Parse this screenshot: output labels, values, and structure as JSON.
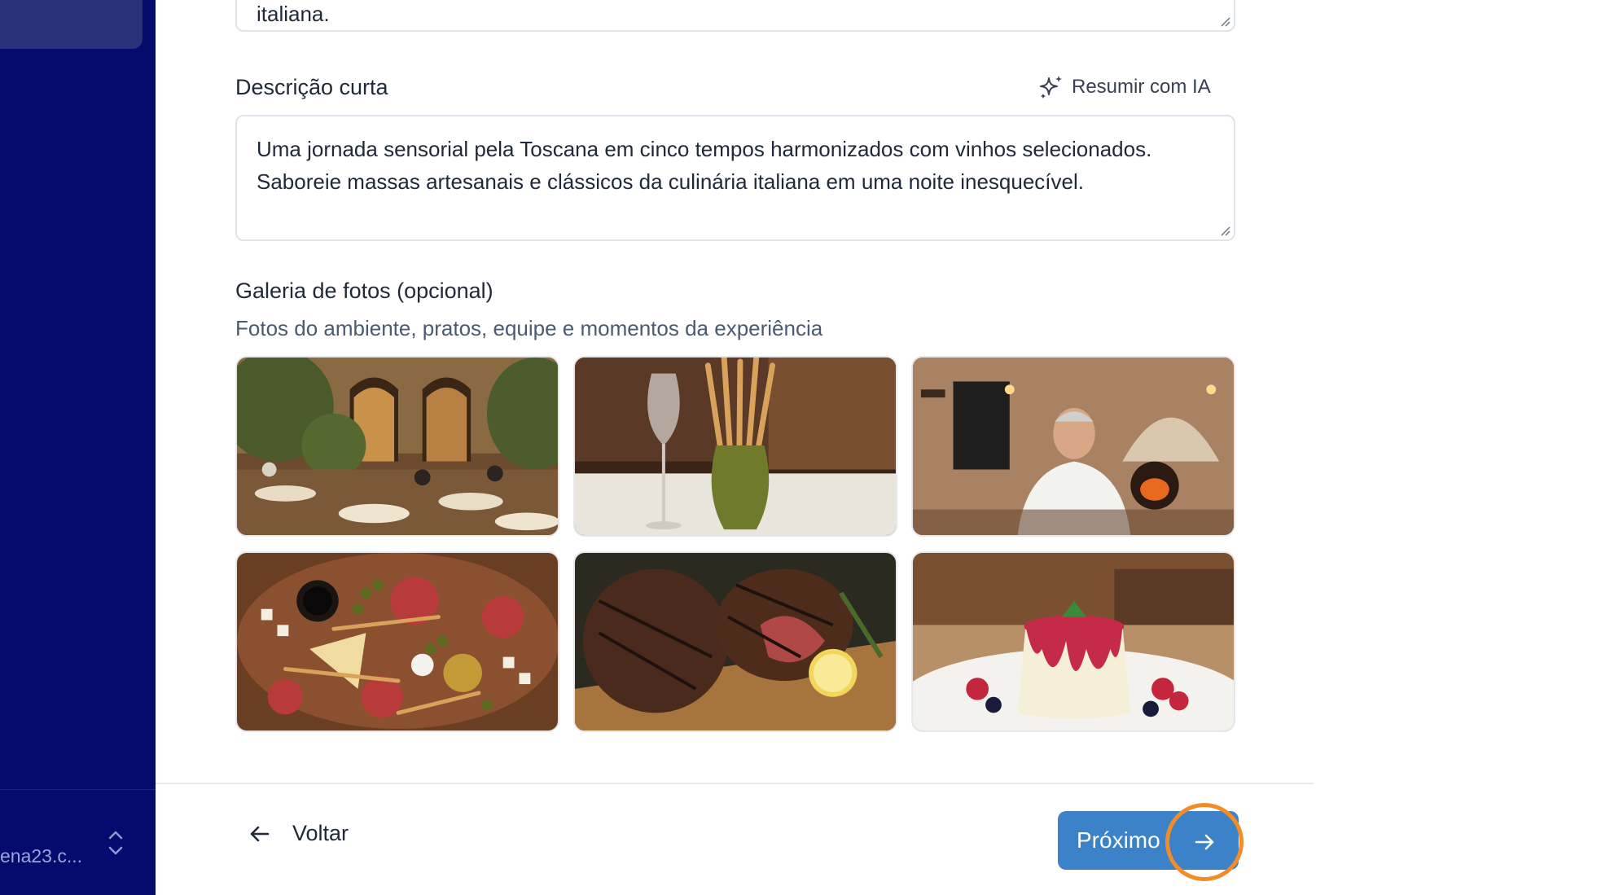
{
  "sidebar": {
    "user_email": "ena23.c..."
  },
  "form": {
    "long_description_tail": "italiana.",
    "short_description": {
      "label": "Descrição curta",
      "ai_button_label": "Resumir com IA",
      "value": "Uma jornada sensorial pela Toscana em cinco tempos harmonizados com vinhos selecionados. Saboreie massas artesanais e clássicos da culinária italiana em uma noite inesquecível."
    },
    "gallery": {
      "label": "Galeria de fotos (opcional)",
      "help": "Fotos do ambiente, pratos, equipe e momentos da experiência",
      "photos": [
        "restaurant-terrace-photo",
        "wine-glass-breadsticks-photo",
        "chef-portrait-photo",
        "antipasto-board-photo",
        "grilled-steak-photo",
        "panna-cotta-photo"
      ]
    }
  },
  "footer": {
    "back_label": "Voltar",
    "next_label": "Próximo"
  },
  "colors": {
    "sidebar_bg": "#050a6e",
    "primary_button": "#3b82c9",
    "focus_ring": "#f28c28"
  }
}
